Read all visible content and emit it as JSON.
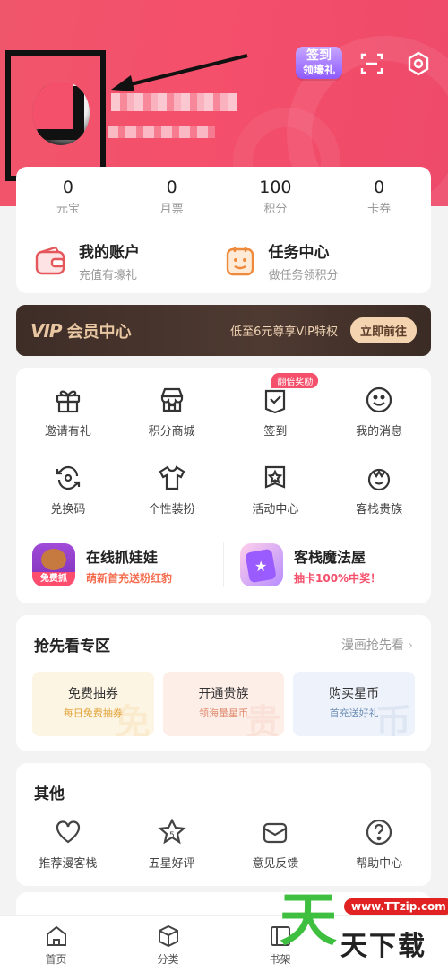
{
  "header": {
    "signin_badge": [
      "签到",
      "领壕礼"
    ]
  },
  "stats": [
    {
      "value": "0",
      "label": "元宝"
    },
    {
      "value": "0",
      "label": "月票"
    },
    {
      "value": "100",
      "label": "积分"
    },
    {
      "value": "0",
      "label": "卡券"
    }
  ],
  "shortcuts": [
    {
      "title": "我的账户",
      "subtitle": "充值有壕礼",
      "icon": "wallet-icon"
    },
    {
      "title": "任务中心",
      "subtitle": "做任务领积分",
      "icon": "task-icon"
    }
  ],
  "vip": {
    "logo": "VIP",
    "title": "会员中心",
    "desc": "低至6元尊享VIP特权",
    "button": "立即前往"
  },
  "grid": [
    {
      "label": "邀请有礼",
      "icon": "gift-icon"
    },
    {
      "label": "积分商城",
      "icon": "store-icon"
    },
    {
      "label": "签到",
      "icon": "checkin-icon",
      "tag": "翻倍奖励"
    },
    {
      "label": "我的消息",
      "icon": "smile-message-icon"
    },
    {
      "label": "兑换码",
      "icon": "exchange-code-icon"
    },
    {
      "label": "个性装扮",
      "icon": "tshirt-icon"
    },
    {
      "label": "活动中心",
      "icon": "star-badge-icon"
    },
    {
      "label": "客栈贵族",
      "icon": "crown-icon"
    }
  ],
  "promos": [
    {
      "title": "在线抓娃娃",
      "subtitle": "萌新首充送粉红豹",
      "badge": "免费抓"
    },
    {
      "title": "客栈魔法屋",
      "subtitle": "抽卡100%中奖！"
    }
  ],
  "early_access": {
    "title": "抢先看专区",
    "more": "漫画抢先看",
    "tiles": [
      {
        "title": "免费抽券",
        "subtitle": "每日免费抽券",
        "bg": "#fdf5e3",
        "color": "#e1a43a",
        "wm": "免"
      },
      {
        "title": "开通贵族",
        "subtitle": "领海量星币",
        "bg": "#fdeee8",
        "color": "#e08a6e",
        "wm": "贵"
      },
      {
        "title": "购买星币",
        "subtitle": "首充送好礼",
        "bg": "#eef3fb",
        "color": "#6f8fb8",
        "wm": "币"
      }
    ]
  },
  "other": {
    "title": "其他",
    "items": [
      {
        "label": "推荐漫客栈",
        "icon": "heart-icon"
      },
      {
        "label": "五星好评",
        "icon": "five-star-icon"
      },
      {
        "label": "意见反馈",
        "icon": "feedback-icon"
      },
      {
        "label": "帮助中心",
        "icon": "help-icon"
      }
    ]
  },
  "tabs": [
    {
      "label": "首页",
      "icon": "home-icon"
    },
    {
      "label": "分类",
      "icon": "category-icon"
    },
    {
      "label": "书架",
      "icon": "bookshelf-icon"
    },
    {
      "label": "",
      "icon": "profile-icon"
    }
  ],
  "watermark": {
    "big": "天",
    "url": "www.TTzip.com",
    "text": "天下载"
  }
}
